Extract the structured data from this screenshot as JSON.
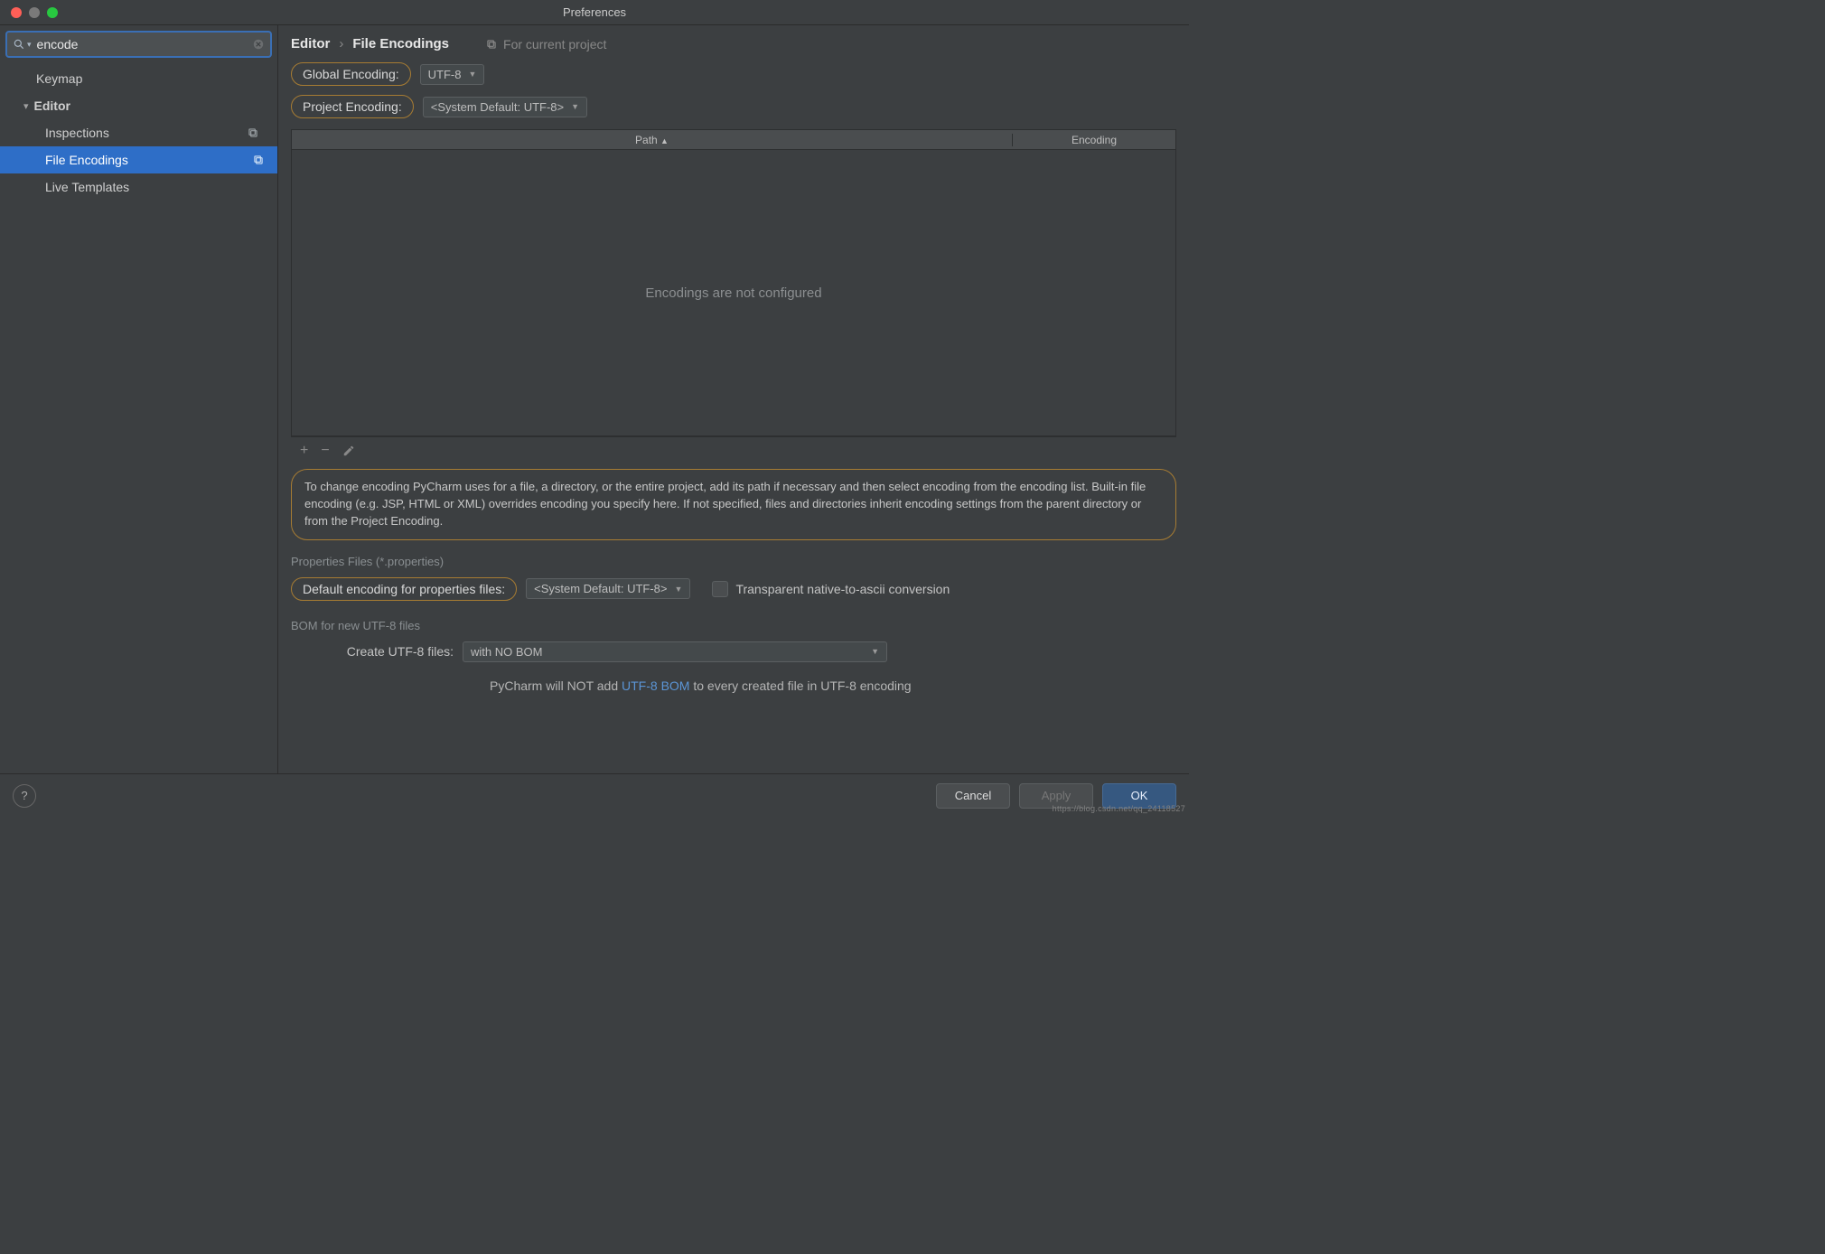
{
  "window": {
    "title": "Preferences"
  },
  "search": {
    "value": "encode"
  },
  "sidebar": {
    "items": [
      {
        "label": "Keymap",
        "level": 1,
        "expandable": false
      },
      {
        "label": "Editor",
        "level": 1,
        "expandable": true
      },
      {
        "label": "Inspections",
        "level": 2,
        "has_copy": true
      },
      {
        "label": "File Encodings",
        "level": 2,
        "has_copy": true,
        "selected": true
      },
      {
        "label": "Live Templates",
        "level": 2
      }
    ]
  },
  "breadcrumb": {
    "root": "Editor",
    "leaf": "File Encodings",
    "scope": "For current project"
  },
  "settings": {
    "global_label": "Global Encoding:",
    "global_value": "UTF-8",
    "project_label": "Project Encoding:",
    "project_value": "<System Default: UTF-8>"
  },
  "table": {
    "col_path": "Path",
    "col_enc": "Encoding",
    "empty": "Encodings are not configured"
  },
  "help_text": "To change encoding PyCharm uses for a file, a directory, or the entire project, add its path if necessary and then select encoding from the encoding list. Built-in file encoding (e.g. JSP, HTML or XML) overrides encoding you specify here. If not specified, files and directories inherit encoding settings from the parent directory or from the Project Encoding.",
  "properties": {
    "section": "Properties Files (*.properties)",
    "default_label": "Default encoding for properties files:",
    "default_value": "<System Default: UTF-8>",
    "transparent_label": "Transparent native-to-ascii conversion"
  },
  "bom": {
    "section": "BOM for new UTF-8 files",
    "create_label": "Create UTF-8 files:",
    "create_value": "with NO BOM",
    "info_pre": "PyCharm will NOT add ",
    "info_link": "UTF-8 BOM",
    "info_post": " to every created file in UTF-8 encoding"
  },
  "footer": {
    "cancel": "Cancel",
    "apply": "Apply",
    "ok": "OK"
  },
  "watermark": "https://blog.csdn.net/qq_24118527"
}
